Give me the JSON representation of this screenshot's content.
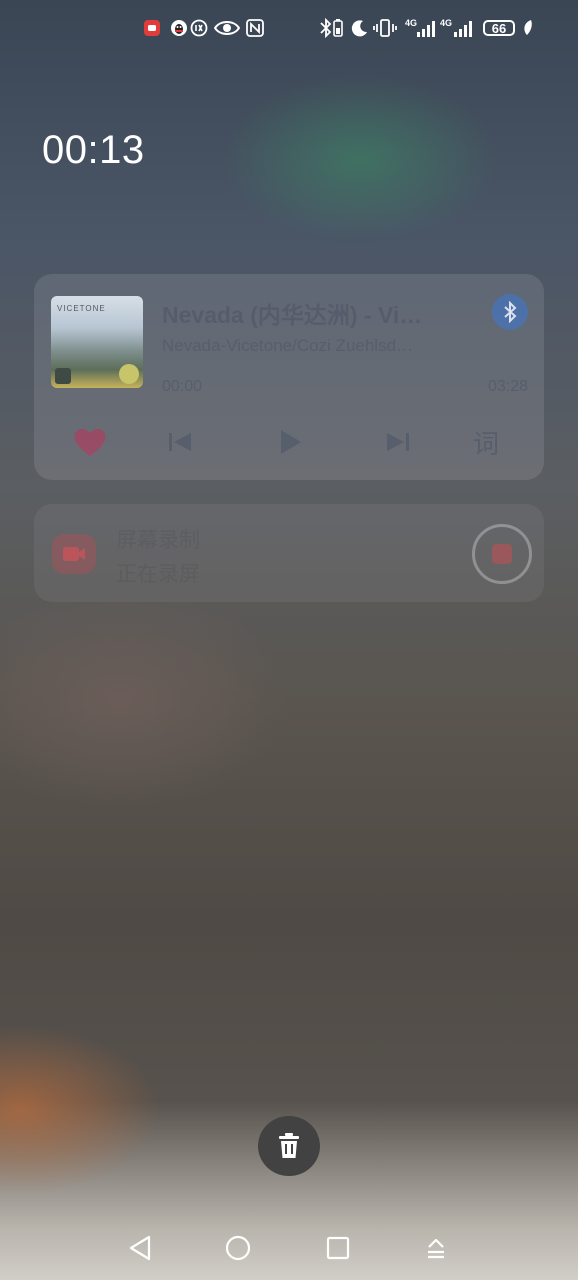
{
  "status_bar": {
    "battery": "66",
    "network_left": "4G",
    "network_right": "4G"
  },
  "lock": {
    "time": "00:13"
  },
  "music_card": {
    "title": "Nevada (内华达洲) - Vi…",
    "artist": "Nevada-Vicetone/Cozi Zuehlsd…",
    "album_label": "VICETONE",
    "elapsed": "00:00",
    "duration": "03:28",
    "progress": 0.0,
    "lyrics_label": "词",
    "colors": {
      "heart": "#c0325a",
      "bluetooth": "#3c78d2"
    }
  },
  "record_card": {
    "title": "屏幕录制",
    "subtitle": "正在录屏",
    "accent": "#dc4650"
  },
  "icons": {
    "trash": "trash-icon",
    "nav_back": "back-triangle-icon",
    "nav_home": "home-circle-icon",
    "nav_recents": "recents-square-icon",
    "nav_menu": "upload-menu-icon"
  }
}
